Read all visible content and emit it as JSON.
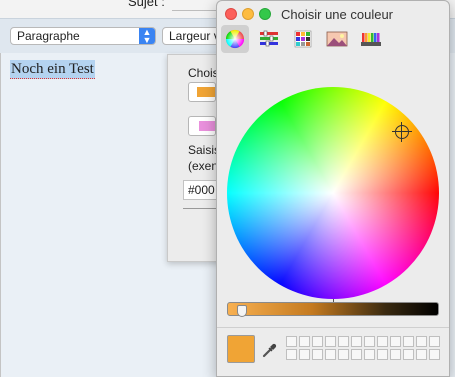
{
  "mail": {
    "subject_label": "Sujet :",
    "format_select": "Paragraphe",
    "width_button": "Largeur v",
    "body_text": "Noch ein Test"
  },
  "properties_panel": {
    "label_top": "Chois",
    "label_input_1": "Saisis",
    "label_input_2": "(exen",
    "hex_value": "#000",
    "color_1": "#f0a435",
    "color_2": "#e990dc"
  },
  "color_picker": {
    "title": "Choisir une couleur",
    "tabs": [
      {
        "icon": "color-wheel-icon",
        "selected": true
      },
      {
        "icon": "sliders-icon",
        "selected": false
      },
      {
        "icon": "palettes-icon",
        "selected": false
      },
      {
        "icon": "image-palettes-icon",
        "selected": false
      },
      {
        "icon": "crayons-icon",
        "selected": false
      }
    ],
    "current_color": "#f0a435",
    "brightness_percent": 98,
    "swatch_rows": 2,
    "swatch_cols": 12
  }
}
